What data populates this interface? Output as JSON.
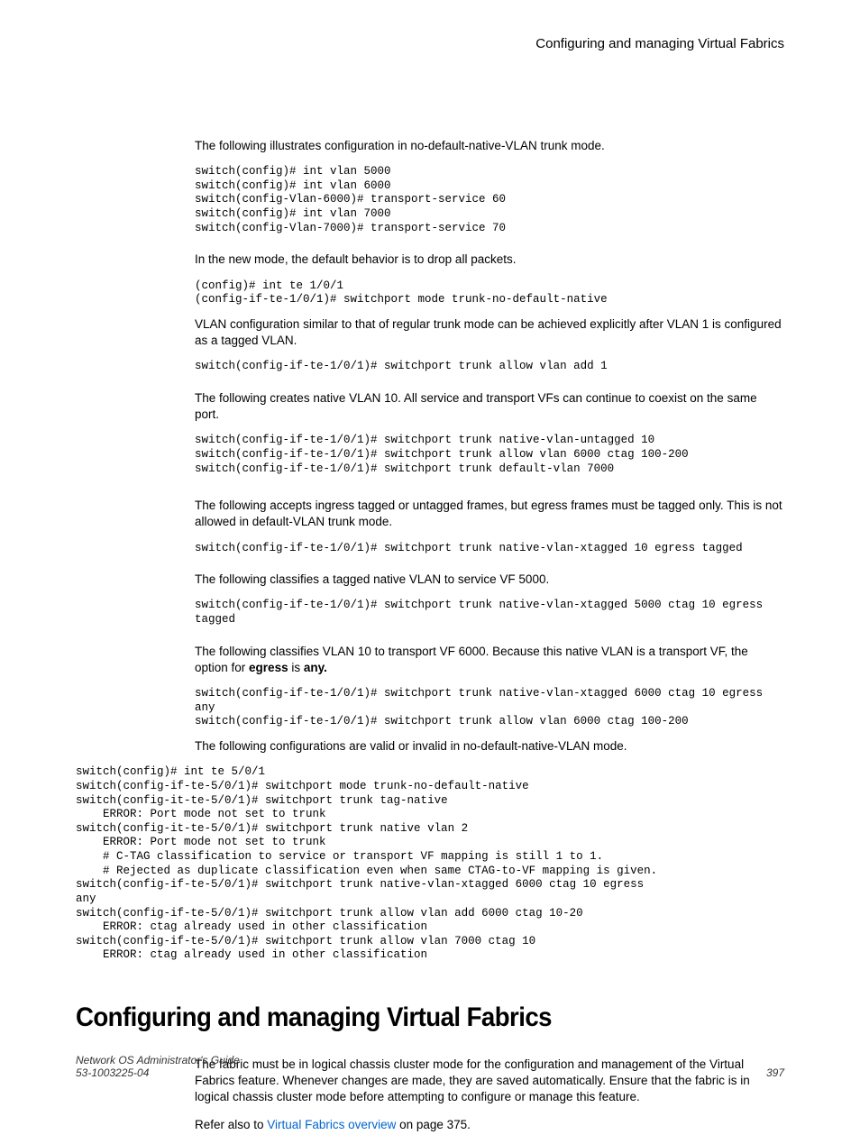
{
  "header": {
    "running_title": "Configuring and managing Virtual Fabrics"
  },
  "content": {
    "p1": "The following illustrates configuration in no-default-native-VLAN trunk mode.",
    "code1": "switch(config)# int vlan 5000\nswitch(config)# int vlan 6000\nswitch(config-Vlan-6000)# transport-service 60\nswitch(config)# int vlan 7000\nswitch(config-Vlan-7000)# transport-service 70",
    "p2": "In the new mode, the default behavior is to drop all packets.",
    "code2": "(config)# int te 1/0/1\n(config-if-te-1/0/1)# switchport mode trunk-no-default-native",
    "p3": "VLAN configuration similar to that of regular trunk mode can be achieved explicitly after VLAN 1 is configured as a tagged VLAN.",
    "code3": "switch(config-if-te-1/0/1)# switchport trunk allow vlan add 1",
    "p4": "The following creates native VLAN 10. All service and transport VFs can continue to coexist on the same port.",
    "code4": "switch(config-if-te-1/0/1)# switchport trunk native-vlan-untagged 10\nswitch(config-if-te-1/0/1)# switchport trunk allow vlan 6000 ctag 100-200\nswitch(config-if-te-1/0/1)# switchport trunk default-vlan 7000",
    "p5": "The following accepts ingress tagged or untagged frames, but egress frames must be tagged only. This is not allowed in default-VLAN trunk mode.",
    "code5": "switch(config-if-te-1/0/1)# switchport trunk native-vlan-xtagged 10 egress tagged",
    "p6": "The following classifies a tagged native VLAN to service VF 5000.",
    "code6": "switch(config-if-te-1/0/1)# switchport trunk native-vlan-xtagged 5000 ctag 10 egress\ntagged",
    "p7_a": "The following classifies VLAN 10 to transport VF 6000. Because this native VLAN is a transport VF, the option for ",
    "p7_b": "egress",
    "p7_c": " is ",
    "p7_d": "any.",
    "code7": "switch(config-if-te-1/0/1)# switchport trunk native-vlan-xtagged 6000 ctag 10 egress\nany\nswitch(config-if-te-1/0/1)# switchport trunk allow vlan 6000 ctag 100-200",
    "p8": "The following configurations are valid or invalid in no-default-native-VLAN mode.",
    "code8": "switch(config)# int te 5/0/1\nswitch(config-if-te-5/0/1)# switchport mode trunk-no-default-native\nswitch(config-it-te-5/0/1)# switchport trunk tag-native\n    ERROR: Port mode not set to trunk\nswitch(config-it-te-5/0/1)# switchport trunk native vlan 2\n    ERROR: Port mode not set to trunk\n    # C-TAG classification to service or transport VF mapping is still 1 to 1.\n    # Rejected as duplicate classification even when same CTAG-to-VF mapping is given.\nswitch(config-if-te-5/0/1)# switchport trunk native-vlan-xtagged 6000 ctag 10 egress\nany\nswitch(config-if-te-5/0/1)# switchport trunk allow vlan add 6000 ctag 10-20\n    ERROR: ctag already used in other classification\nswitch(config-if-te-5/0/1)# switchport trunk allow vlan 7000 ctag 10\n    ERROR: ctag already used in other classification",
    "h1": "Configuring and managing Virtual Fabrics",
    "p9": "The fabric must be in logical chassis cluster mode for the configuration and management of the Virtual Fabrics feature. Whenever changes are made, they are saved automatically. Ensure that the fabric is in logical chassis cluster mode before attempting to configure or manage this feature.",
    "p10_a": "Refer also to ",
    "p10_link": "Virtual Fabrics overview",
    "p10_b": " on page 375."
  },
  "footer": {
    "left1": "Network OS Administrator's Guide",
    "left2": "53-1003225-04",
    "right": "397"
  }
}
